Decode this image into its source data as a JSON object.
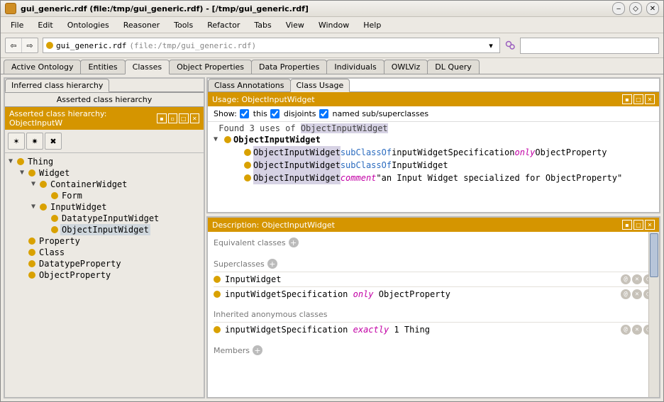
{
  "window": {
    "title": "gui_generic.rdf (file:/tmp/gui_generic.rdf) - [/tmp/gui_generic.rdf]"
  },
  "menu": {
    "items": [
      "File",
      "Edit",
      "Ontologies",
      "Reasoner",
      "Tools",
      "Refactor",
      "Tabs",
      "View",
      "Window",
      "Help"
    ]
  },
  "address": {
    "main": "gui_generic.rdf",
    "hint": "(file:/tmp/gui_generic.rdf)"
  },
  "search": {
    "placeholder": ""
  },
  "mainTabs": [
    "Active Ontology",
    "Entities",
    "Classes",
    "Object Properties",
    "Data Properties",
    "Individuals",
    "OWLViz",
    "DL Query"
  ],
  "mainTabActive": 2,
  "leftSubTabs": [
    "Inferred class hierarchy"
  ],
  "leftHeaderPlain": "Asserted class hierarchy",
  "leftHeaderOrange": "Asserted class hierarchy: ObjectInputW",
  "tree": [
    {
      "depth": 0,
      "toggle": "▼",
      "label": "Thing"
    },
    {
      "depth": 1,
      "toggle": "▼",
      "label": "Widget"
    },
    {
      "depth": 2,
      "toggle": "▼",
      "label": "ContainerWidget"
    },
    {
      "depth": 3,
      "toggle": "",
      "label": "Form"
    },
    {
      "depth": 2,
      "toggle": "▼",
      "label": "InputWidget"
    },
    {
      "depth": 3,
      "toggle": "",
      "label": "DatatypeInputWidget"
    },
    {
      "depth": 3,
      "toggle": "",
      "label": "ObjectInputWidget",
      "selected": true
    },
    {
      "depth": 1,
      "toggle": "",
      "label": "Property"
    },
    {
      "depth": 1,
      "toggle": "",
      "label": "Class"
    },
    {
      "depth": 1,
      "toggle": "",
      "label": "DatatypeProperty"
    },
    {
      "depth": 1,
      "toggle": "",
      "label": "ObjectProperty"
    }
  ],
  "rightTopTabs": [
    "Class Annotations",
    "Class Usage"
  ],
  "rightTopTabActive": 1,
  "usage": {
    "header": "Usage: ObjectInputWidget",
    "showLabel": "Show:",
    "opt1": "this",
    "opt2": "disjoints",
    "opt3": "named sub/superclasses",
    "foundPrefix": "Found 3 uses of ",
    "foundClass": "ObjectInputWidget",
    "rootClass": "ObjectInputWidget",
    "lines": [
      {
        "a": "ObjectInputWidget",
        "b": "subClassOf",
        "c": "inputWidgetSpecification",
        "d": "only",
        "e": "ObjectProperty"
      },
      {
        "a": "ObjectInputWidget",
        "b": "subClassOf",
        "c": "InputWidget"
      },
      {
        "a": "ObjectInputWidget",
        "b": "comment",
        "c": "\"an Input Widget specialized for ObjectProperty\""
      }
    ]
  },
  "desc": {
    "header": "Description: ObjectInputWidget",
    "secEquiv": "Equivalent classes",
    "secSuper": "Superclasses",
    "superRows": [
      {
        "text": "InputWidget"
      },
      {
        "parts": [
          "inputWidgetSpecification",
          " only ",
          "ObjectProperty"
        ],
        "styled": true
      }
    ],
    "secInherited": "Inherited anonymous classes",
    "inheritedRow": {
      "parts": [
        "inputWidgetSpecification",
        " exactly ",
        "1 Thing"
      ],
      "styled": true
    },
    "secMembers": "Members"
  }
}
